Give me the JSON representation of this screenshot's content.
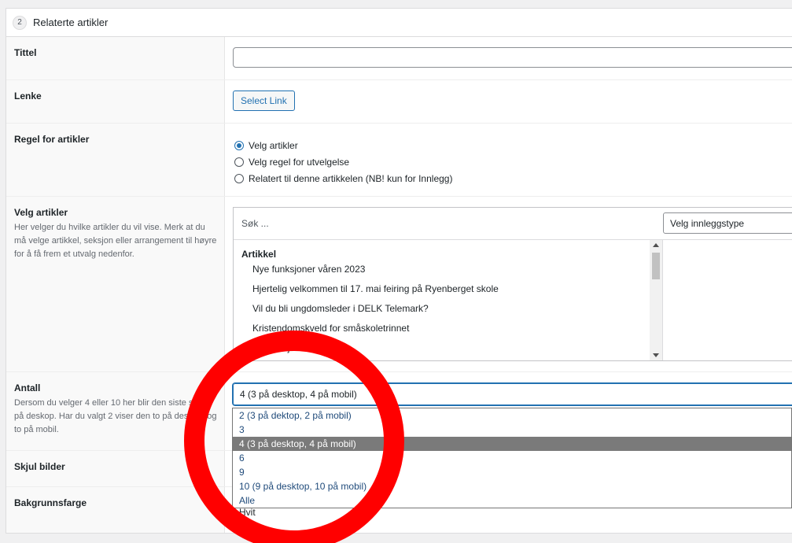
{
  "section": {
    "number": "2",
    "title": "Relaterte artikler"
  },
  "fields": {
    "tittel": {
      "label": "Tittel",
      "value": ""
    },
    "lenke": {
      "label": "Lenke",
      "button": "Select Link"
    },
    "regel": {
      "label": "Regel for artikler",
      "options": [
        {
          "label": "Velg artikler",
          "checked": true
        },
        {
          "label": "Velg regel for utvelgelse",
          "checked": false
        },
        {
          "label": "Relatert til denne artikkelen (NB! kun for Innlegg)",
          "checked": false
        }
      ]
    },
    "velg_artikler": {
      "label": "Velg artikler",
      "description": "Her velger du hvilke artikler du vil vise. Merk at du må velge artikkel, seksjon eller arrangement til høyre for å få frem et utvalg nedenfor.",
      "search_placeholder": "Søk ...",
      "type_select": "Velg innleggstype",
      "group": "Artikkel",
      "items": [
        "Nye funksjoner våren 2023",
        "Hjertelig velkommen til 17. mai feiring på Ryenberget skole",
        "Vil du bli ungdomsleder i DELK Telemark?",
        "Kristendomskveld for småskoletrinnet",
        "Roser, bjørk og stauder"
      ]
    },
    "antall": {
      "label": "Antall",
      "description": "Dersom du velger 4 eller 10 her blir den siste skjult på deskop. Har du valgt 2 viser den to på desktop og to på mobil.",
      "value": "4 (3 på desktop, 4 på mobil)",
      "options": [
        "2 (3 på dektop, 2 på mobil)",
        "3",
        "4 (3 på desktop, 4 på mobil)",
        "6",
        "9",
        "10 (9 på desktop, 10 på mobil)",
        "Alle"
      ],
      "selected_index": 2
    },
    "skjul_bilder": {
      "label": "Skjul bilder"
    },
    "bakgrunnsfarge": {
      "label": "Bakgrunnsfarge",
      "value": "Hvit"
    }
  },
  "annotation": {
    "color": "#ff0000"
  }
}
